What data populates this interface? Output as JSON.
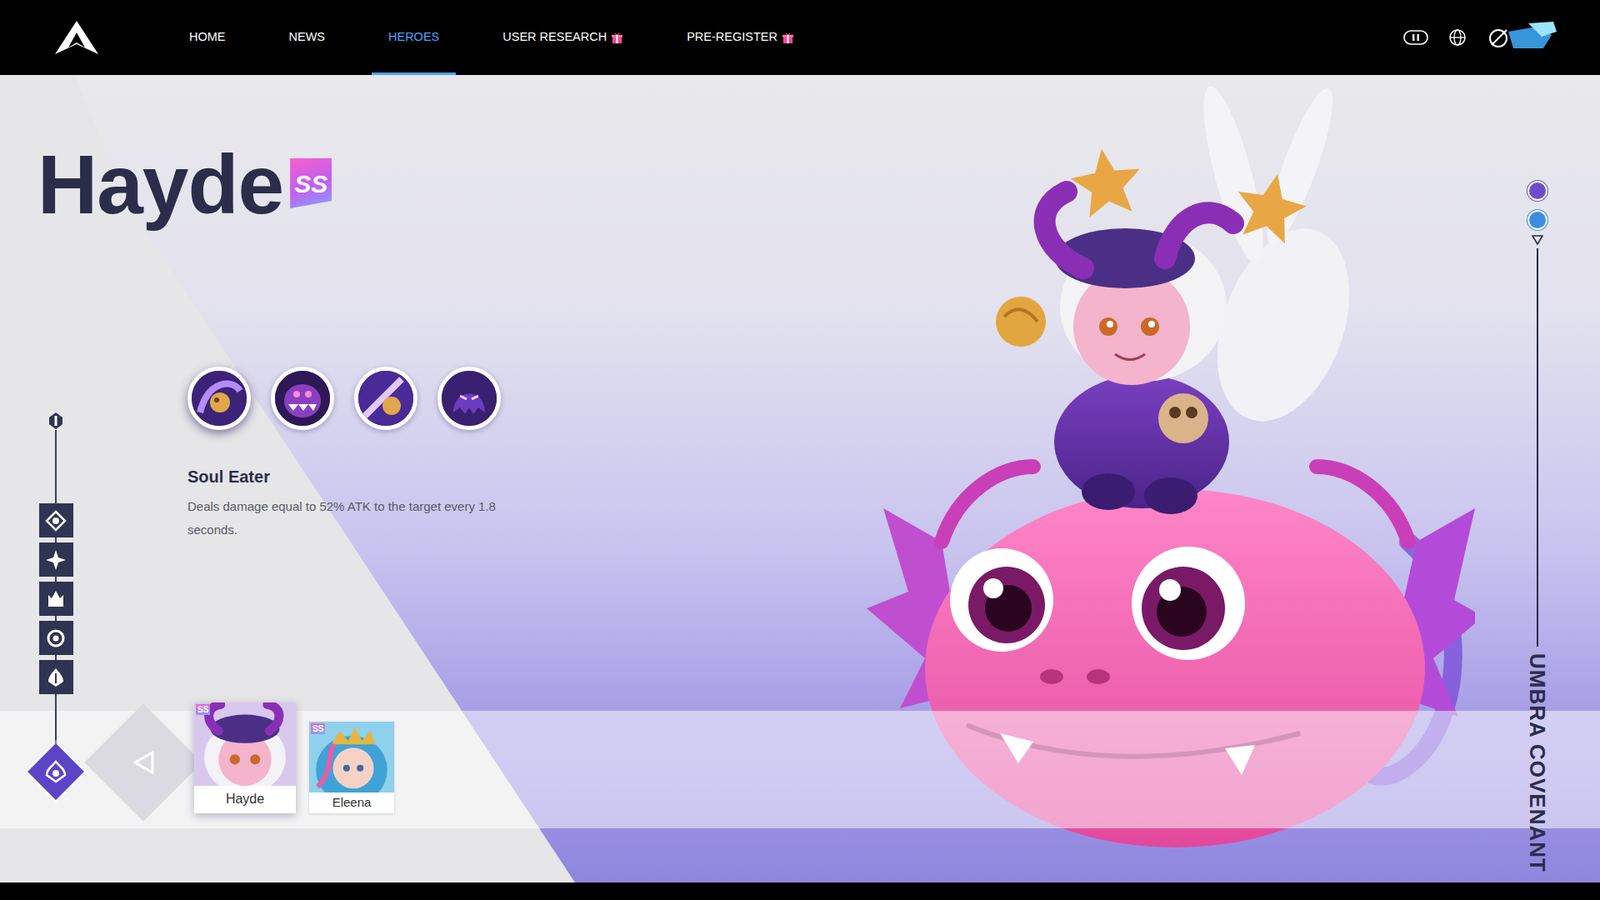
{
  "nav": {
    "items": [
      {
        "label": "HOME",
        "selected": false,
        "gift": false
      },
      {
        "label": "NEWS",
        "selected": false,
        "gift": false
      },
      {
        "label": "HEROES",
        "selected": true,
        "gift": false
      },
      {
        "label": "USER RESEARCH",
        "selected": false,
        "gift": true
      },
      {
        "label": "PRE-REGISTER",
        "selected": false,
        "gift": true
      }
    ]
  },
  "hero": {
    "name": "Hayde",
    "rank": "SS"
  },
  "skills": [
    {
      "selected": true
    },
    {
      "selected": false
    },
    {
      "selected": false
    },
    {
      "selected": false
    }
  ],
  "skill_detail": {
    "title": "Soul Eater",
    "description": "Deals damage equal to 52% ATK to the target every 1.8 seconds."
  },
  "faction_filters": [
    {
      "selected": false
    },
    {
      "selected": false
    },
    {
      "selected": false
    },
    {
      "selected": false
    },
    {
      "selected": false
    }
  ],
  "faction": {
    "name": "UMBRA COVENANT"
  },
  "roster": [
    {
      "name": "Hayde",
      "rank": "SS",
      "selected": true
    },
    {
      "name": "Eleena",
      "rank": "SS",
      "selected": false
    }
  ]
}
